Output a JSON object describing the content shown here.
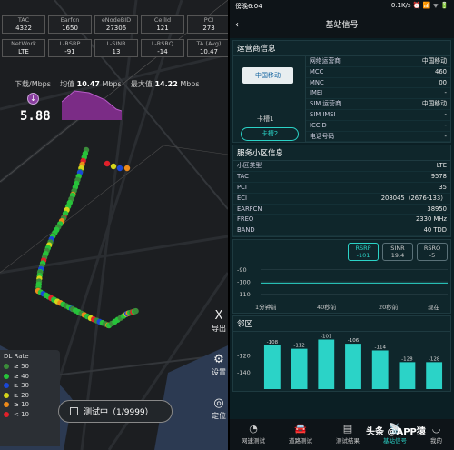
{
  "left": {
    "stats_top": [
      {
        "label": "TAC",
        "value": "4322"
      },
      {
        "label": "Earfcn",
        "value": "1650"
      },
      {
        "label": "eNodeBID",
        "value": "27306"
      },
      {
        "label": "CellId",
        "value": "121"
      },
      {
        "label": "PCI",
        "value": "273"
      }
    ],
    "stats_bottom": [
      {
        "label": "NetWork",
        "value": "LTE"
      },
      {
        "label": "L-RSRP",
        "value": "-91"
      },
      {
        "label": "L-SINR",
        "value": "13"
      },
      {
        "label": "L-RSRQ",
        "value": "-14"
      },
      {
        "label": "TA (Avg)",
        "value": "10.47"
      }
    ],
    "download_label": "下载/Mbps",
    "avg_label": "均值",
    "avg_value": "10.47",
    "avg_unit": "Mbps",
    "max_label": "最大值",
    "max_value": "14.22",
    "max_unit": "Mbps",
    "current_value": "5.88",
    "dl_icon": "↓",
    "legend": {
      "title": "DL Rate",
      "items": [
        {
          "label": "≥ 50",
          "color": "#3a8c3a"
        },
        {
          "label": "≥ 40",
          "color": "#27c23a"
        },
        {
          "label": "≥ 30",
          "color": "#1a47d6"
        },
        {
          "label": "≥ 20",
          "color": "#d4d41a"
        },
        {
          "label": "≥ 10",
          "color": "#ec8a1a"
        },
        {
          "label": "< 10",
          "color": "#e0202a"
        }
      ]
    },
    "side_buttons": [
      {
        "label": "导出",
        "icon": "export-icon",
        "glyph": "X"
      },
      {
        "label": "设置",
        "icon": "gear-icon",
        "glyph": "⚙"
      },
      {
        "label": "定位",
        "icon": "locate-icon",
        "glyph": "◎"
      }
    ],
    "test_status": "测试中（1/9999）"
  },
  "right": {
    "status_time": "傍晚6:04",
    "status_right": "0.1K/s ⏰ 📶 ᯤ 🔋",
    "title": "基站信号",
    "operator": {
      "header": "运营商信息",
      "logo_text": "中国移动",
      "slot1": "卡槽1",
      "slot2": "卡槽2",
      "rows": [
        {
          "k": "网络运营商",
          "v": "中国移动"
        },
        {
          "k": "MCC",
          "v": "460"
        },
        {
          "k": "MNC",
          "v": "00"
        },
        {
          "k": "IMEI",
          "v": "-"
        },
        {
          "k": "SIM 运营商",
          "v": "中国移动"
        },
        {
          "k": "SIM IMSI",
          "v": "-"
        },
        {
          "k": "ICCID",
          "v": "-"
        },
        {
          "k": "电话号码",
          "v": "-"
        }
      ]
    },
    "cell": {
      "header": "服务小区信息",
      "rows": [
        {
          "k": "小区类型",
          "v": "LTE"
        },
        {
          "k": "TAC",
          "v": "9578"
        },
        {
          "k": "PCI",
          "v": "35"
        },
        {
          "k": "ECI",
          "v": "208045（2676-133）"
        },
        {
          "k": "EARFCN",
          "v": "38950"
        },
        {
          "k": "FREQ",
          "v": "2330 MHz"
        },
        {
          "k": "BAND",
          "v": "40 TDD"
        }
      ]
    },
    "chips": [
      {
        "label": "RSRP",
        "value": "-101",
        "selected": true
      },
      {
        "label": "SINR",
        "value": "19.4",
        "selected": false
      },
      {
        "label": "RSRQ",
        "value": "-5",
        "selected": false
      }
    ],
    "chart_data": {
      "type": "line",
      "title": "",
      "ylabel": "",
      "y_ticks": [
        "-90",
        "-100",
        "-110"
      ],
      "x_ticks": [
        "1分钟前",
        "40秒前",
        "20秒前",
        "现在"
      ],
      "series": [
        {
          "values": [
            -101,
            -101,
            -101,
            -101
          ]
        }
      ],
      "ylim": [
        -115,
        -88
      ]
    },
    "neighbor": {
      "header": "邻区",
      "chart_data": {
        "type": "bar",
        "y_ticks": [
          "-120",
          "-140"
        ],
        "values": [
          -108,
          -112,
          -101,
          -106,
          -114,
          -128,
          -128
        ],
        "ylim": [
          -145,
          -95
        ]
      }
    },
    "tabs": [
      {
        "label": "网速测试",
        "icon": "speed-icon",
        "glyph": "◔"
      },
      {
        "label": "道路测试",
        "icon": "car-icon",
        "glyph": "🚘"
      },
      {
        "label": "测试结果",
        "icon": "result-icon",
        "glyph": "▤"
      },
      {
        "label": "基站信号",
        "icon": "tower-icon",
        "glyph": "📡"
      },
      {
        "label": "我的",
        "icon": "user-icon",
        "glyph": "◡"
      }
    ],
    "watermark": "头条 @APP猿"
  }
}
